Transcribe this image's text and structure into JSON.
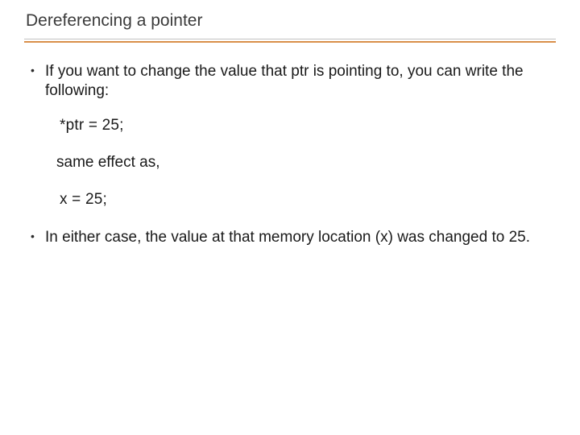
{
  "slide": {
    "title": "Dereferencing a pointer",
    "bullet1": "If you want to change the value that ptr is pointing to, you can write the following:",
    "code1": "*ptr = 25;",
    "note": "same effect as,",
    "code2": "x = 25;",
    "bullet2": "In either case, the value at that memory location (x) was changed to 25."
  }
}
